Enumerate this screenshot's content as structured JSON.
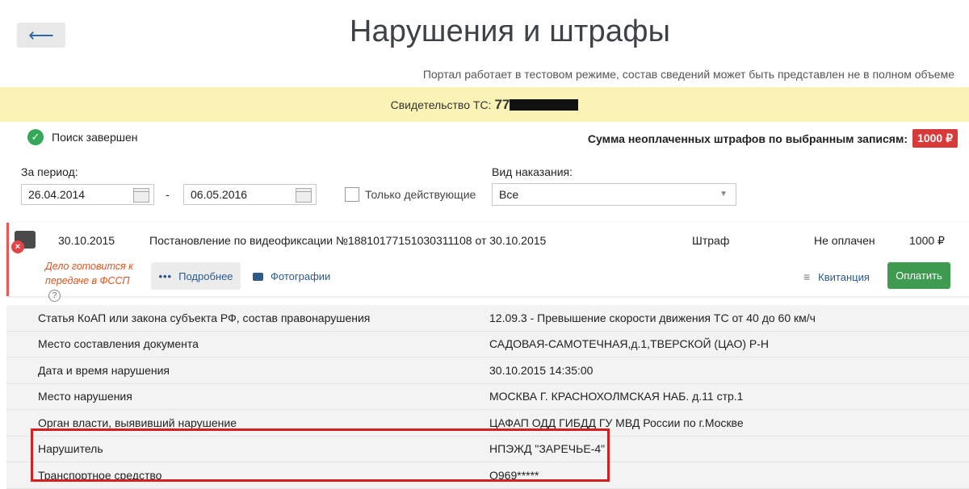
{
  "header": {
    "back_icon": "back-arrow-icon",
    "title": "Нарушения и штрафы",
    "notice": "Портал работает в тестовом режиме, состав сведений может быть представлен не в полном объеме"
  },
  "certificate": {
    "label": "Свидетельство ТС:",
    "number_visible": "77"
  },
  "search": {
    "status": "Поиск завершен",
    "sum_label": "Сумма неоплаченных штрафов по выбранным записям:",
    "sum_value": "1000 ₽"
  },
  "filters": {
    "period_label": "За период:",
    "date_from": "26.04.2014",
    "dash": "-",
    "date_to": "06.05.2016",
    "only_active_label": "Только действующие",
    "punishment_label": "Вид наказания:",
    "punishment_value": "Все"
  },
  "fine": {
    "date": "30.10.2015",
    "description": "Постановление по видеофиксации №18810177151030311108 от 30.10.2015",
    "type": "Штраф",
    "status": "Не оплачен",
    "amount": "1000 ₽",
    "fssp_note": "Дело готовится к передаче в ФССП",
    "help_icon": "?",
    "more_label": "Подробнее",
    "photos_label": "Фотографии",
    "receipt_label": "Квитанция",
    "pay_label": "Оплатить"
  },
  "details": [
    {
      "key": "Статья КоАП или закона субъекта РФ, состав правонарушения",
      "value": "12.09.3 - Превышение скорости движения ТС от 40 до 60 км/ч"
    },
    {
      "key": "Место составления документа",
      "value": "САДОВАЯ-САМОТЕЧНАЯ,д.1,ТВЕРСКОЙ (ЦАО) Р-Н"
    },
    {
      "key": "Дата и время нарушения",
      "value": "30.10.2015 14:35:00"
    },
    {
      "key": "Место нарушения",
      "value": "МОСКВА Г. КРАСНОХОЛМСКАЯ НАБ. д.11 стр.1"
    },
    {
      "key": "Орган власти, выявивший нарушение",
      "value": "ЦАФАП ОДД ГИБДД ГУ МВД России по г.Москве"
    },
    {
      "key": "Нарушитель",
      "value": "НПЭЖД \"ЗАРЕЧЬЕ-4\""
    },
    {
      "key": "Транспортное средство",
      "value": "О969*****"
    }
  ],
  "colors": {
    "cert_bar": "#fbf3b5",
    "badge_red": "#d83a3a",
    "pay_green": "#3e9b50",
    "highlight_red": "#d62020"
  }
}
